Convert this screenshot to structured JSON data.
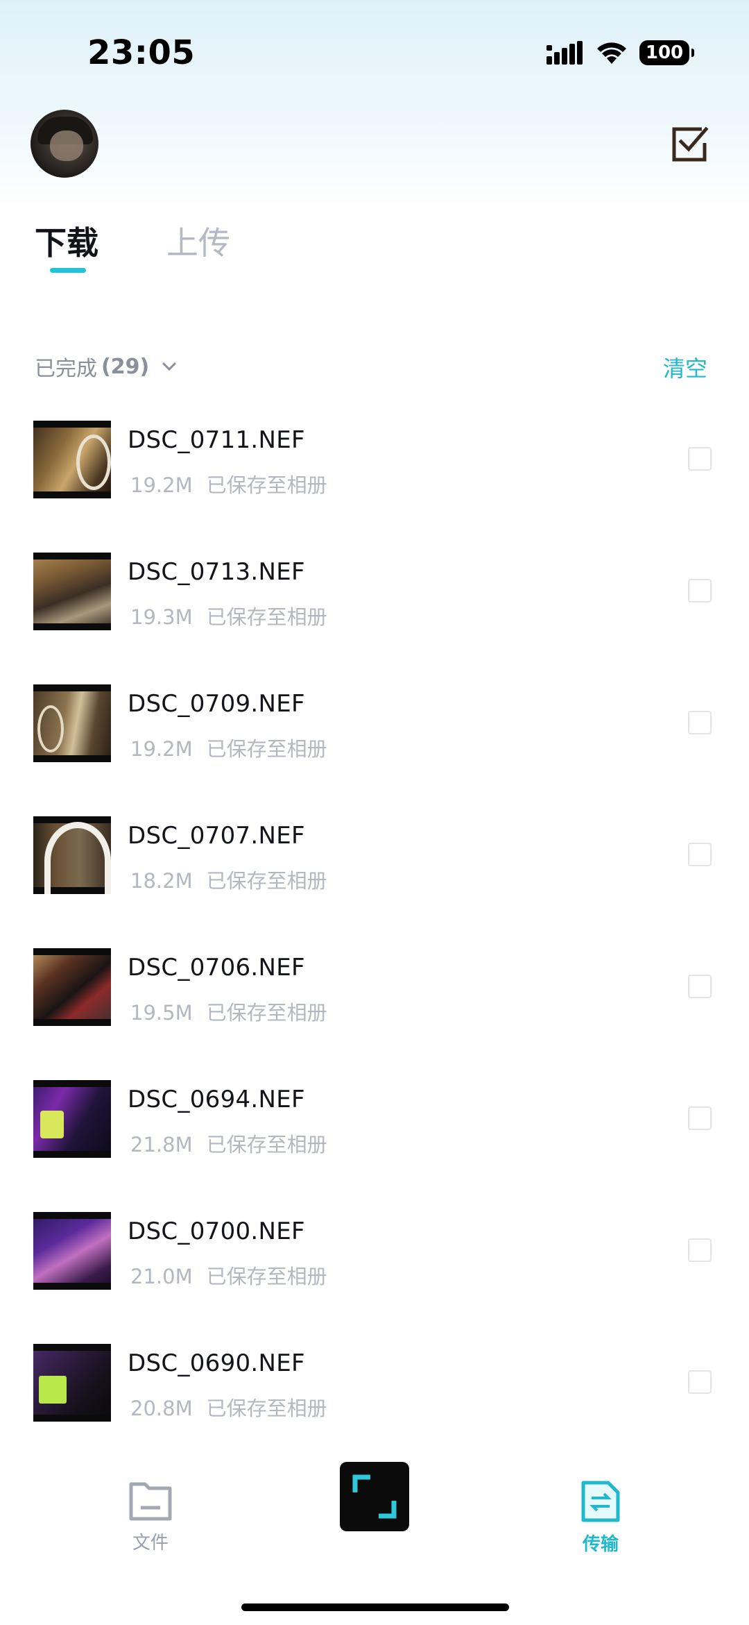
{
  "status_bar": {
    "time": "23:05",
    "battery": "100",
    "icons": [
      "signal-icon",
      "wifi-icon",
      "battery-icon"
    ]
  },
  "header": {
    "avatar": "avatar",
    "select_icon": "checkbox-select-icon"
  },
  "tabs": [
    {
      "label": "下载",
      "active": true
    },
    {
      "label": "上传",
      "active": false
    }
  ],
  "section": {
    "label": "已完成",
    "count": "(29)",
    "clear_label": "清空"
  },
  "files": [
    {
      "name": "DSC_0711.NEF",
      "size": "19.2M",
      "status": "已保存至相册"
    },
    {
      "name": "DSC_0713.NEF",
      "size": "19.3M",
      "status": "已保存至相册"
    },
    {
      "name": "DSC_0709.NEF",
      "size": "19.2M",
      "status": "已保存至相册"
    },
    {
      "name": "DSC_0707.NEF",
      "size": "18.2M",
      "status": "已保存至相册"
    },
    {
      "name": "DSC_0706.NEF",
      "size": "19.5M",
      "status": "已保存至相册"
    },
    {
      "name": "DSC_0694.NEF",
      "size": "21.8M",
      "status": "已保存至相册"
    },
    {
      "name": "DSC_0700.NEF",
      "size": "21.0M",
      "status": "已保存至相册"
    },
    {
      "name": "DSC_0690.NEF",
      "size": "20.8M",
      "status": "已保存至相册"
    }
  ],
  "tabbar": {
    "files_label": "文件",
    "transfer_label": "传输",
    "scan_icon": "scan-icon"
  },
  "colors": {
    "accent": "#21c3d6",
    "muted_text": "#b3b7bf"
  }
}
